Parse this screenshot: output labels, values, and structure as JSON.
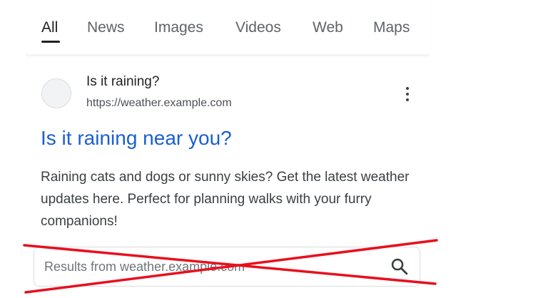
{
  "tabs": [
    {
      "label": "All",
      "active": true
    },
    {
      "label": "News",
      "active": false
    },
    {
      "label": "Images",
      "active": false
    },
    {
      "label": "Videos",
      "active": false
    },
    {
      "label": "Web",
      "active": false
    },
    {
      "label": "Maps",
      "active": false
    }
  ],
  "result": {
    "site_name": "Is it raining?",
    "url": "https://weather.example.com",
    "title": "Is it raining near you?",
    "snippet": "Raining cats and dogs or sunny skies? Get the latest weather updates here. Perfect for planning walks with your furry companions!",
    "favicon_icon": "globe-placeholder-icon",
    "menu_icon": "more-vert-icon"
  },
  "site_search": {
    "placeholder": "Results from weather.example.com",
    "value": "",
    "icon": "search-icon",
    "crossed_out": true
  },
  "colors": {
    "link": "#1a5fd0",
    "text": "#202124",
    "secondary_text": "#5f6368",
    "cross_mark": "#e8101e"
  }
}
